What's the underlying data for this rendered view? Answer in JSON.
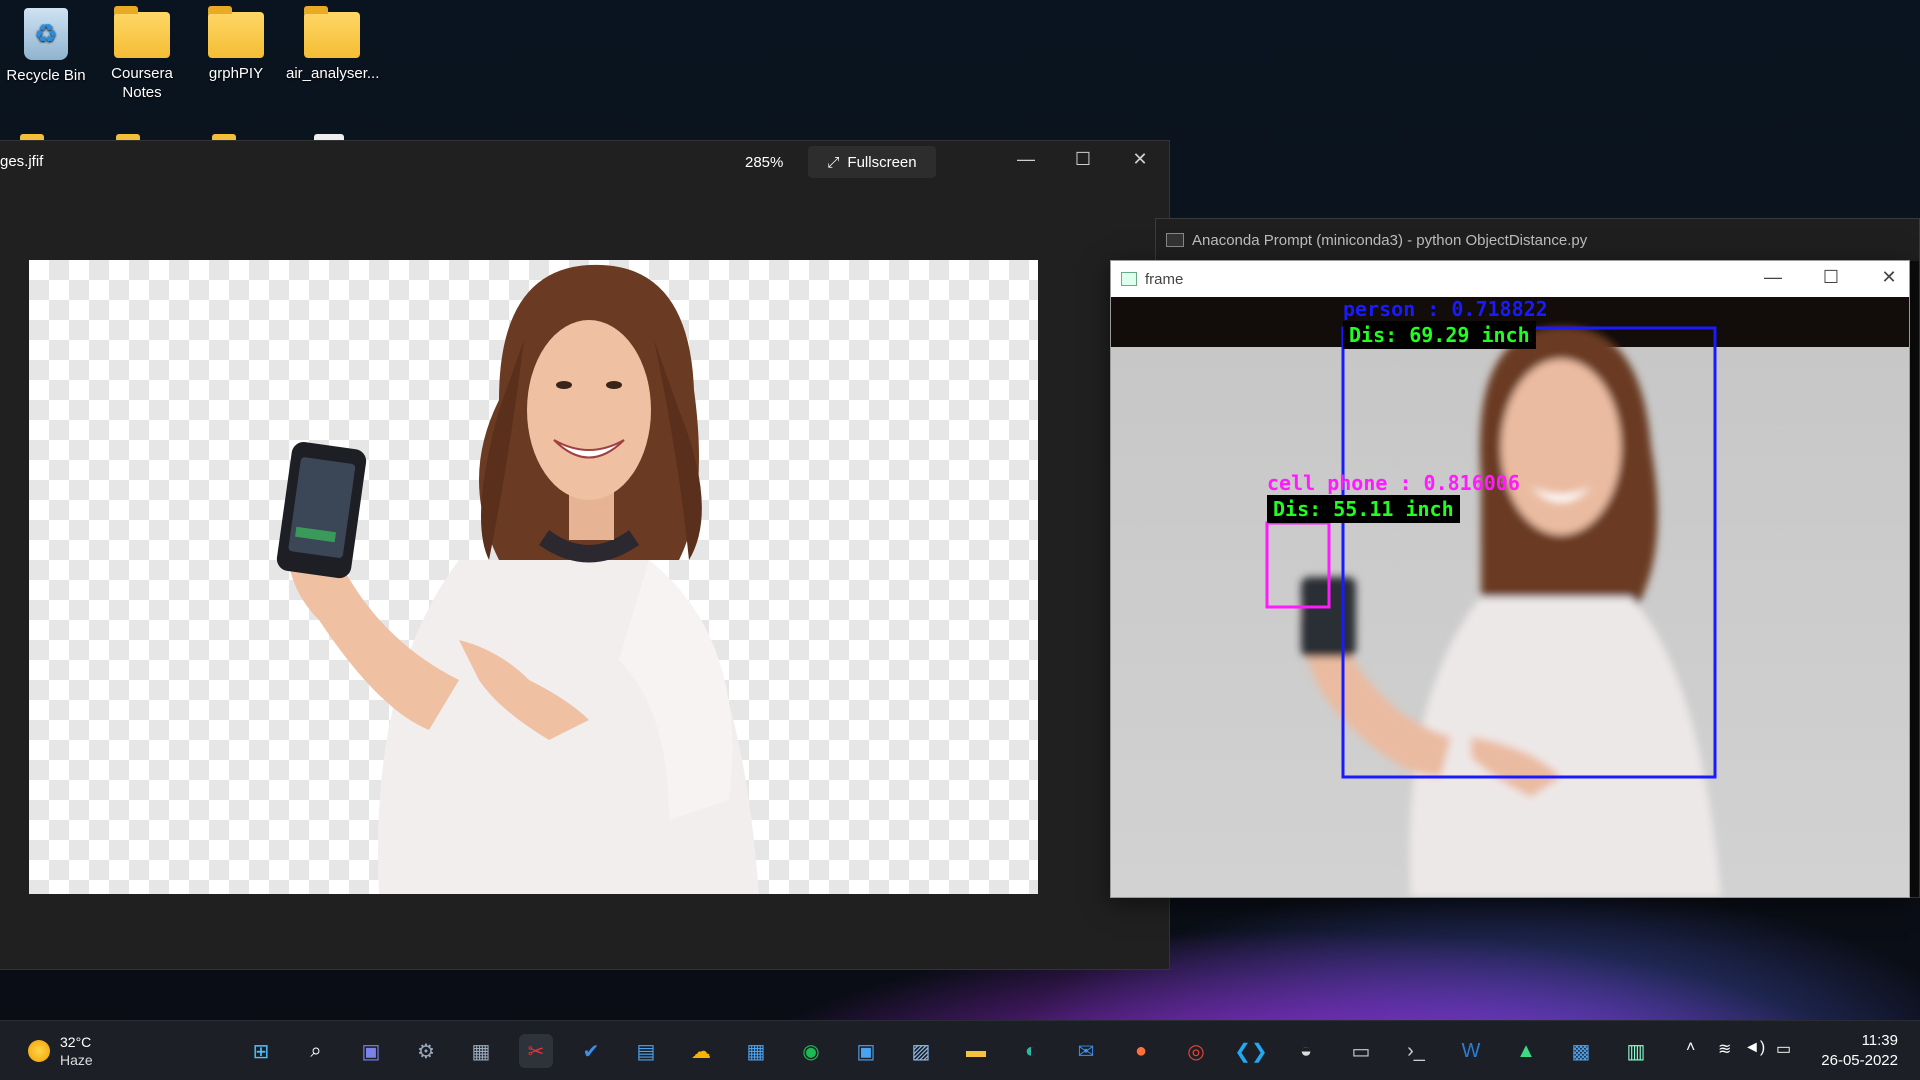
{
  "desktop": {
    "icons": [
      {
        "label": "Recycle Bin",
        "type": "recycle-bin"
      },
      {
        "label": "Coursera Notes",
        "type": "folder"
      },
      {
        "label": "grphPIY",
        "type": "folder"
      },
      {
        "label": "air_analyser...",
        "type": "folder"
      }
    ]
  },
  "photos_window": {
    "title": "ges.jfif",
    "zoom": "285%",
    "fullscreen_label": "Fullscreen",
    "fullscreen_icon": "expand-icon"
  },
  "anaconda_window": {
    "title": "Anaconda Prompt (miniconda3) - python  ObjectDistance.py"
  },
  "frame_window": {
    "title": "frame",
    "detections": [
      {
        "label": "person : 0.718822",
        "distance": "Dis: 69.29 inch",
        "color": "#1a1aff"
      },
      {
        "label": "cell phone : 0.816006",
        "distance": "Dis: 55.11 inch",
        "color": "#ff1aff"
      }
    ]
  },
  "taskbar": {
    "weather_temp": "32°C",
    "weather_desc": "Haze",
    "time": "11:39",
    "date": "26-05-2022",
    "apps": [
      "start-icon",
      "search-icon",
      "chat-icon",
      "settings-icon",
      "calculator-icon",
      "snipping-tool-icon",
      "todo-icon",
      "notepad-icon",
      "weather-app-icon",
      "calendar-icon",
      "spotify-icon",
      "news-icon",
      "photos-icon",
      "file-explorer-icon",
      "edge-icon",
      "mail-icon",
      "firefox-icon",
      "chrome-icon",
      "vscode-icon",
      "eclipse-icon",
      "terminal-icon",
      "cmd-icon",
      "word-icon",
      "android-studio-icon",
      "pictures-icon",
      "app-window-icon"
    ]
  },
  "colors": {
    "accent": "#0078d4",
    "detection_text_green": "#21ff21"
  }
}
